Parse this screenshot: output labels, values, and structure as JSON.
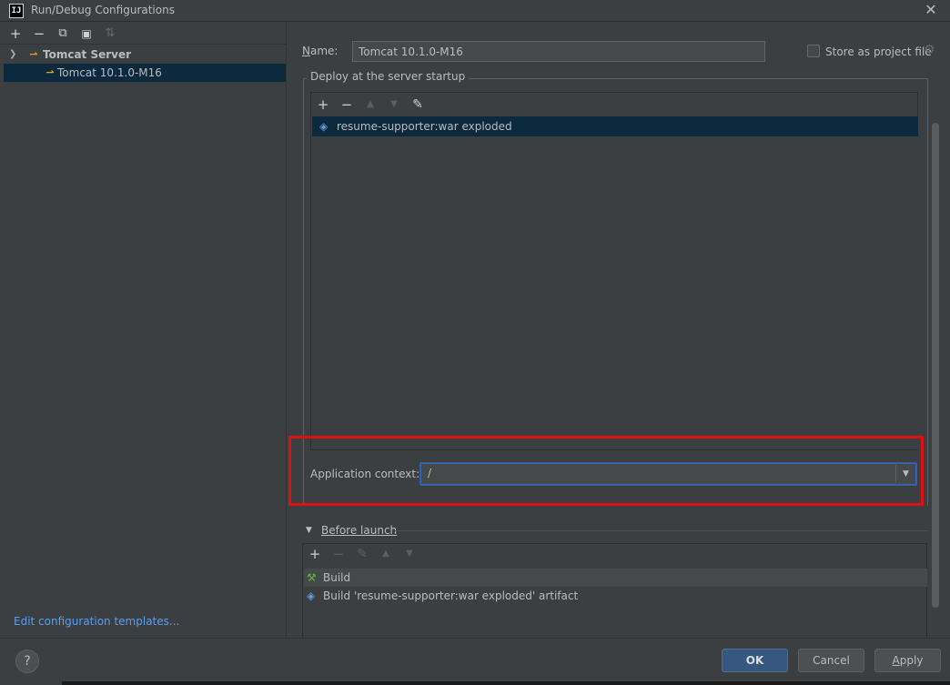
{
  "window": {
    "title": "Run/Debug Configurations",
    "app_icon_text": "IJ",
    "close_glyph": "✕"
  },
  "left_toolbar": {
    "add": "+",
    "remove": "−",
    "copy": "⧉",
    "folder": "▣",
    "sort": "⇅"
  },
  "tree": {
    "group": {
      "label": "Tomcat Server",
      "expanded": true,
      "icon": "tomcat-icon"
    },
    "items": [
      {
        "label": "Tomcat 10.1.0-M16",
        "icon": "tomcat-icon",
        "selected": true
      }
    ]
  },
  "edit_templates_link": "Edit configuration templates...",
  "name_field": {
    "label_mnemonic": "N",
    "label_rest": "ame:",
    "value": "Tomcat 10.1.0-M16"
  },
  "store_as_project_file": {
    "label": "Store as project file",
    "checked": false
  },
  "deploy": {
    "title": "Deploy at the server startup",
    "toolbar": {
      "add": "+",
      "remove": "−",
      "up": "▲",
      "down": "▼",
      "edit": "✎"
    },
    "items": [
      {
        "label": "resume-supporter:war exploded",
        "icon": "artifact-icon",
        "selected": true
      }
    ]
  },
  "application_context": {
    "label": "Application context:",
    "value": "/"
  },
  "before_launch": {
    "label": "Before launch",
    "toolbar": {
      "add": "+",
      "remove": "−",
      "edit": "✎",
      "up": "▲",
      "down": "▼"
    },
    "items": [
      {
        "label": "Build",
        "icon": "hammer-icon"
      },
      {
        "label": "Build 'resume-supporter:war exploded' artifact",
        "icon": "artifact-icon"
      }
    ]
  },
  "buttons": {
    "help": "?",
    "ok": "OK",
    "cancel": "Cancel",
    "apply_mnemonic": "A",
    "apply_rest": "pply"
  },
  "colors": {
    "accent_blue": "#365880",
    "selection": "#0d293e",
    "highlight_red": "#e01010",
    "link": "#589df6"
  }
}
